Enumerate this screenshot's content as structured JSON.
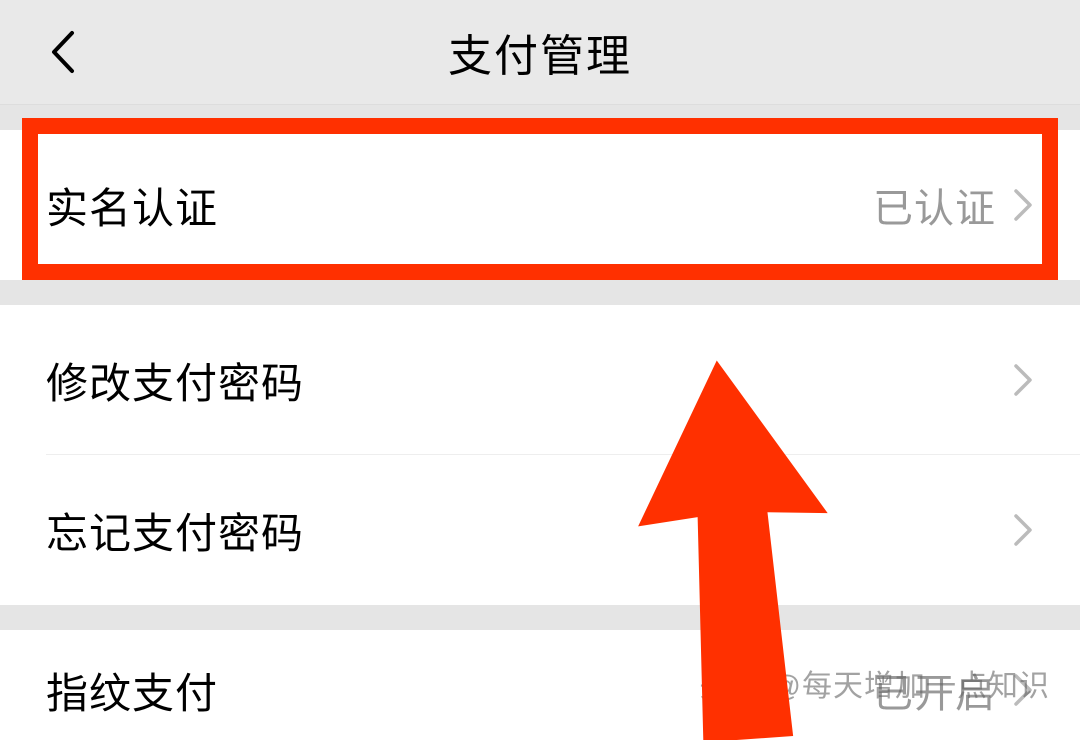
{
  "header": {
    "title": "支付管理"
  },
  "rows": {
    "realname": {
      "label": "实名认证",
      "value": "已认证"
    },
    "change_pwd": {
      "label": "修改支付密码"
    },
    "forgot_pwd": {
      "label": "忘记支付密码"
    },
    "fingerprint": {
      "label": "指纹支付",
      "value": "已开启"
    }
  },
  "watermark": "头条 @每天增加一点知识",
  "annotation": {
    "highlight_color": "#ff3000",
    "arrow_color": "#ff3000"
  }
}
